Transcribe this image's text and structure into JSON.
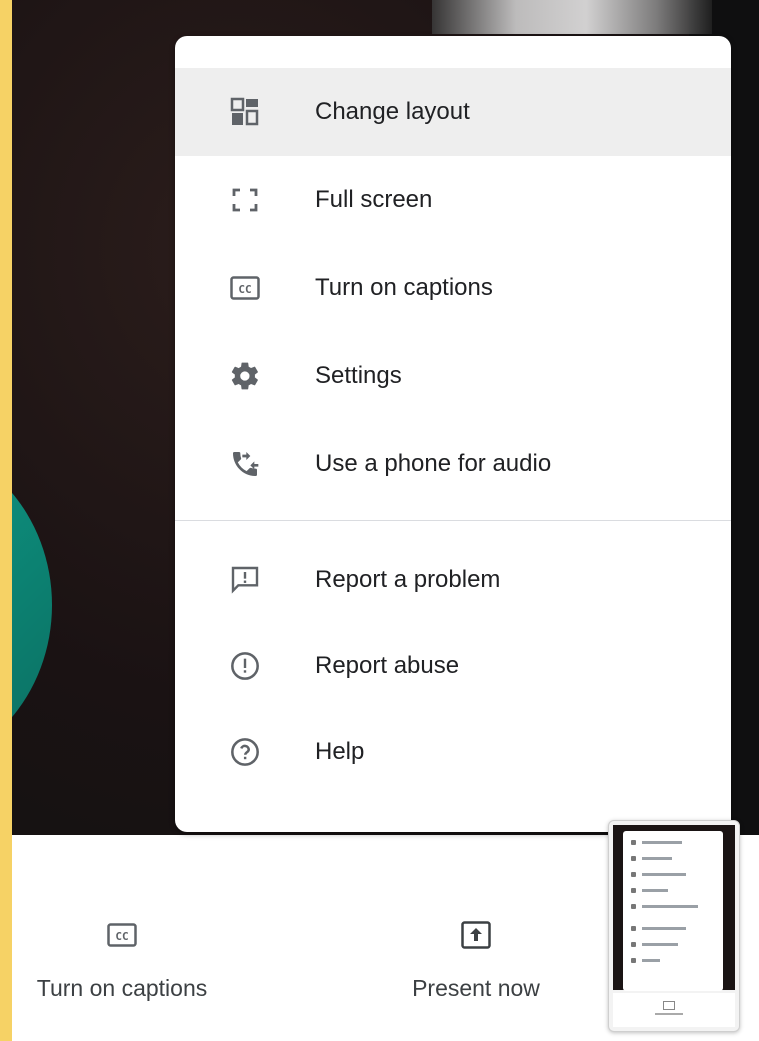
{
  "menu": {
    "items": [
      {
        "label": "Change layout",
        "icon": "layout-icon"
      },
      {
        "label": "Full screen",
        "icon": "fullscreen-icon"
      },
      {
        "label": "Turn on captions",
        "icon": "captions-icon"
      },
      {
        "label": "Settings",
        "icon": "gear-icon"
      },
      {
        "label": "Use a phone for audio",
        "icon": "phone-transfer-icon"
      },
      {
        "label": "Report a problem",
        "icon": "feedback-icon"
      },
      {
        "label": "Report abuse",
        "icon": "alert-circle-icon"
      },
      {
        "label": "Help",
        "icon": "help-circle-icon"
      }
    ]
  },
  "toolbar": {
    "captions_label": "Turn on captions",
    "present_label": "Present now"
  },
  "colors": {
    "frame": "#f6d265",
    "menu_bg": "#ffffff",
    "active_bg": "#eeeeee",
    "icon": "#5f6368",
    "text": "#202124"
  }
}
